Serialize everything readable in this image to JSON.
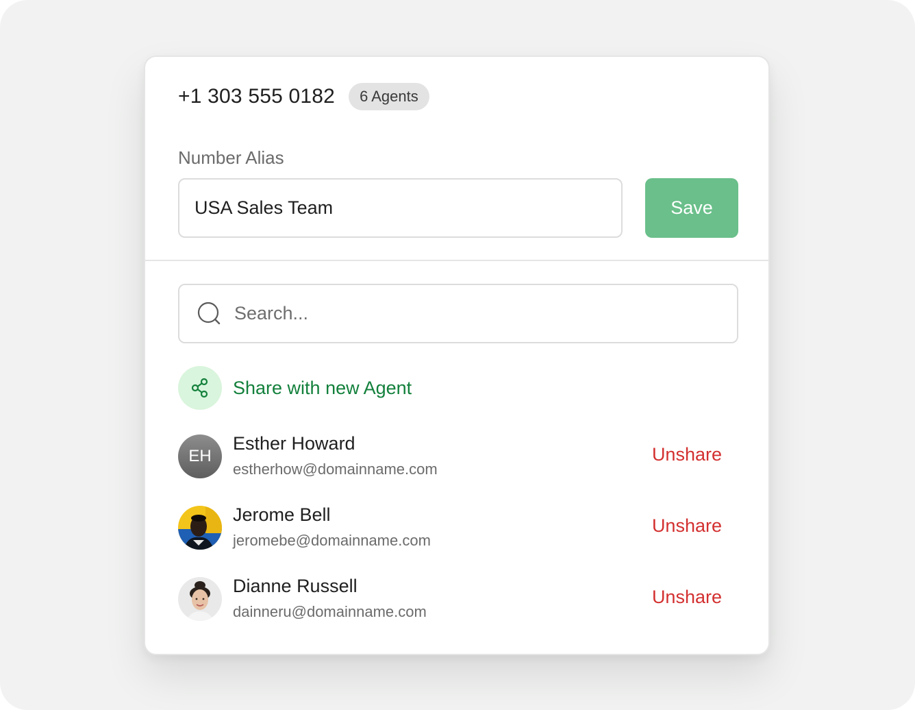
{
  "header": {
    "phone_number": "+1 303 555 0182",
    "agents_badge": "6 Agents"
  },
  "alias": {
    "label": "Number Alias",
    "value": "USA Sales Team",
    "save_label": "Save"
  },
  "search": {
    "placeholder": "Search..."
  },
  "share": {
    "label": "Share with new Agent"
  },
  "agents": [
    {
      "initials": "EH",
      "name": "Esther Howard",
      "email": "estherhow@domainname.com",
      "action": "Unshare"
    },
    {
      "name": "Jerome Bell",
      "email": "jeromebe@domainname.com",
      "action": "Unshare"
    },
    {
      "name": "Dianne Russell",
      "email": "dainneru@domainname.com",
      "action": "Unshare"
    }
  ],
  "colors": {
    "save_button": "#6abf8a",
    "share_text": "#13803c",
    "share_circle": "#d9f5dd",
    "unshare": "#d32f2f"
  }
}
